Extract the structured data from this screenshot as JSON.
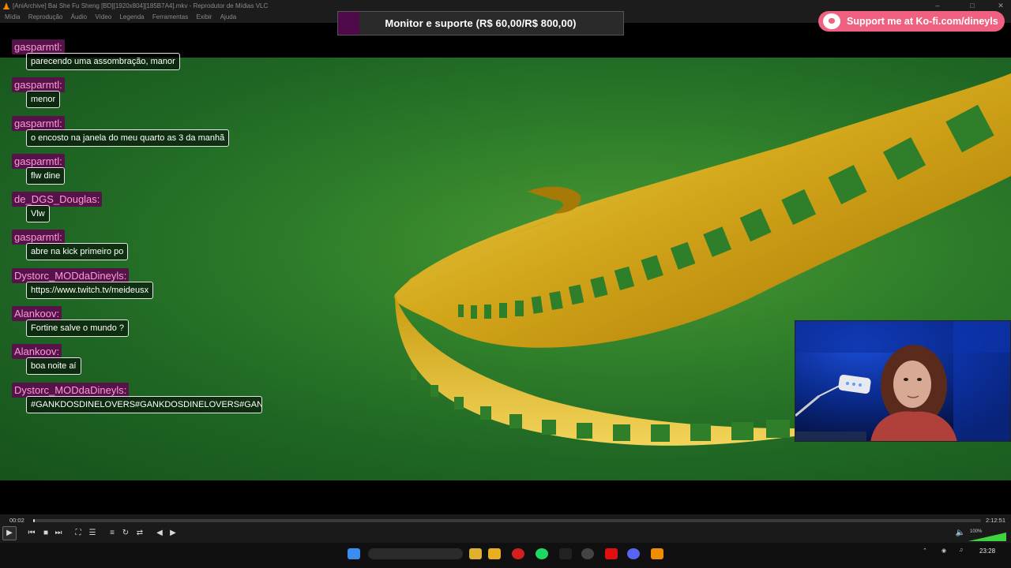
{
  "window": {
    "title": "[AniArchive] Bai She Fu Sheng [BD][1920x804][185B7A4].mkv - Reprodutor de Mídias VLC"
  },
  "menu": [
    "Mídia",
    "Reprodução",
    "Áudio",
    "Vídeo",
    "Legenda",
    "Ferramentas",
    "Exibir",
    "Ajuda"
  ],
  "overlay": {
    "goal_text": "Monitor e suporte (R$ 60,00/R$ 800,00)",
    "goal_progress": 0.075,
    "kofi_text": "Support me at Ko-fi.com/dineyls"
  },
  "chat": [
    {
      "user": "gasparmtl:",
      "text": "parecendo uma assombração, manor"
    },
    {
      "user": "gasparmtl:",
      "text": "menor"
    },
    {
      "user": "gasparmtl:",
      "text": "o encosto na janela do meu quarto as 3 da manhã"
    },
    {
      "user": "gasparmtl:",
      "text": "flw dine"
    },
    {
      "user": "de_DGS_Douglas:",
      "text": "Vlw"
    },
    {
      "user": "gasparmtl:",
      "text": "abre na kick primeiro po"
    },
    {
      "user": "Dystorc_MODdaDineyls:",
      "text": "https://www.twitch.tv/meideusx"
    },
    {
      "user": "Alankoov:",
      "text": "Fortine salve o mundo ?"
    },
    {
      "user": "Alankoov:",
      "text": "boa noite aí"
    },
    {
      "user": "Dystorc_MODdaDineyls:",
      "text": "#GANKDOSDINELOVERS#GANKDOSDINELOVERS#GANKDOSDINELOVERS"
    }
  ],
  "player": {
    "elapsed": "00:02",
    "total": "2:12:51",
    "progress": 0.0002,
    "volume_label": "100%",
    "volume": 1.0
  },
  "taskbar": {
    "time": "23:28"
  },
  "colors": {
    "chat_user_bg": "#561349",
    "chat_user_text": "#ff9ad9",
    "kofi_bg": "#f06080",
    "goal_fill": "#4f0a4a"
  }
}
